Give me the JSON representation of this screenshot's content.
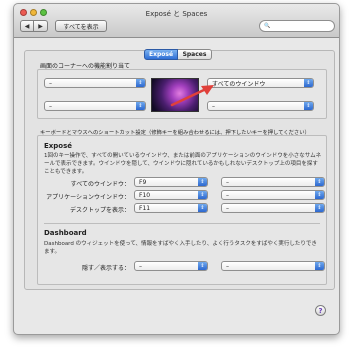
{
  "window": {
    "title": "Exposé と Spaces",
    "show_all_label": "すべてを表示",
    "back_glyph": "◀",
    "forward_glyph": "▶",
    "search_icon": "🔍"
  },
  "tabs": [
    {
      "label": "Exposé"
    },
    {
      "label": "Spaces"
    }
  ],
  "corners": {
    "section_label": "画面のコーナーへの機能割り当て",
    "top_left": "–",
    "bottom_left": "–",
    "top_right": "すべてのウインドウ",
    "bottom_right": "–"
  },
  "shortcuts": {
    "section_label": "キーボードとマウスへのショートカット設定（修飾キーを組み合わせるには、押下したいキーを押してください）"
  },
  "expose": {
    "title": "Exposé",
    "description": "1回のキー操作で、すべての開いているウインドウ、または前面のアプリケーションのウインドウを小さなサムネールで表示できます。ウインドウを隠して、ウインドウに隠れているかもしれないデスクトップ上の項目を探すこともできます。",
    "rows": [
      {
        "label": "すべてのウインドウ：",
        "key": "F9",
        "mouse": "–"
      },
      {
        "label": "アプリケーションウインドウ：",
        "key": "F10",
        "mouse": "–"
      },
      {
        "label": "デスクトップを表示：",
        "key": "F11",
        "mouse": "–"
      }
    ]
  },
  "dashboard": {
    "title": "Dashboard",
    "description": "Dashboard のウィジェットを使って、情報をすばやく入手したり、よく行うタスクをすばやく実行したりできます。",
    "row": {
      "label": "隠す／表示する：",
      "key": "–",
      "mouse": "–"
    }
  },
  "help_label": "?",
  "colors": {
    "accent": "#2d68cf",
    "arrow": "#e0403a"
  }
}
